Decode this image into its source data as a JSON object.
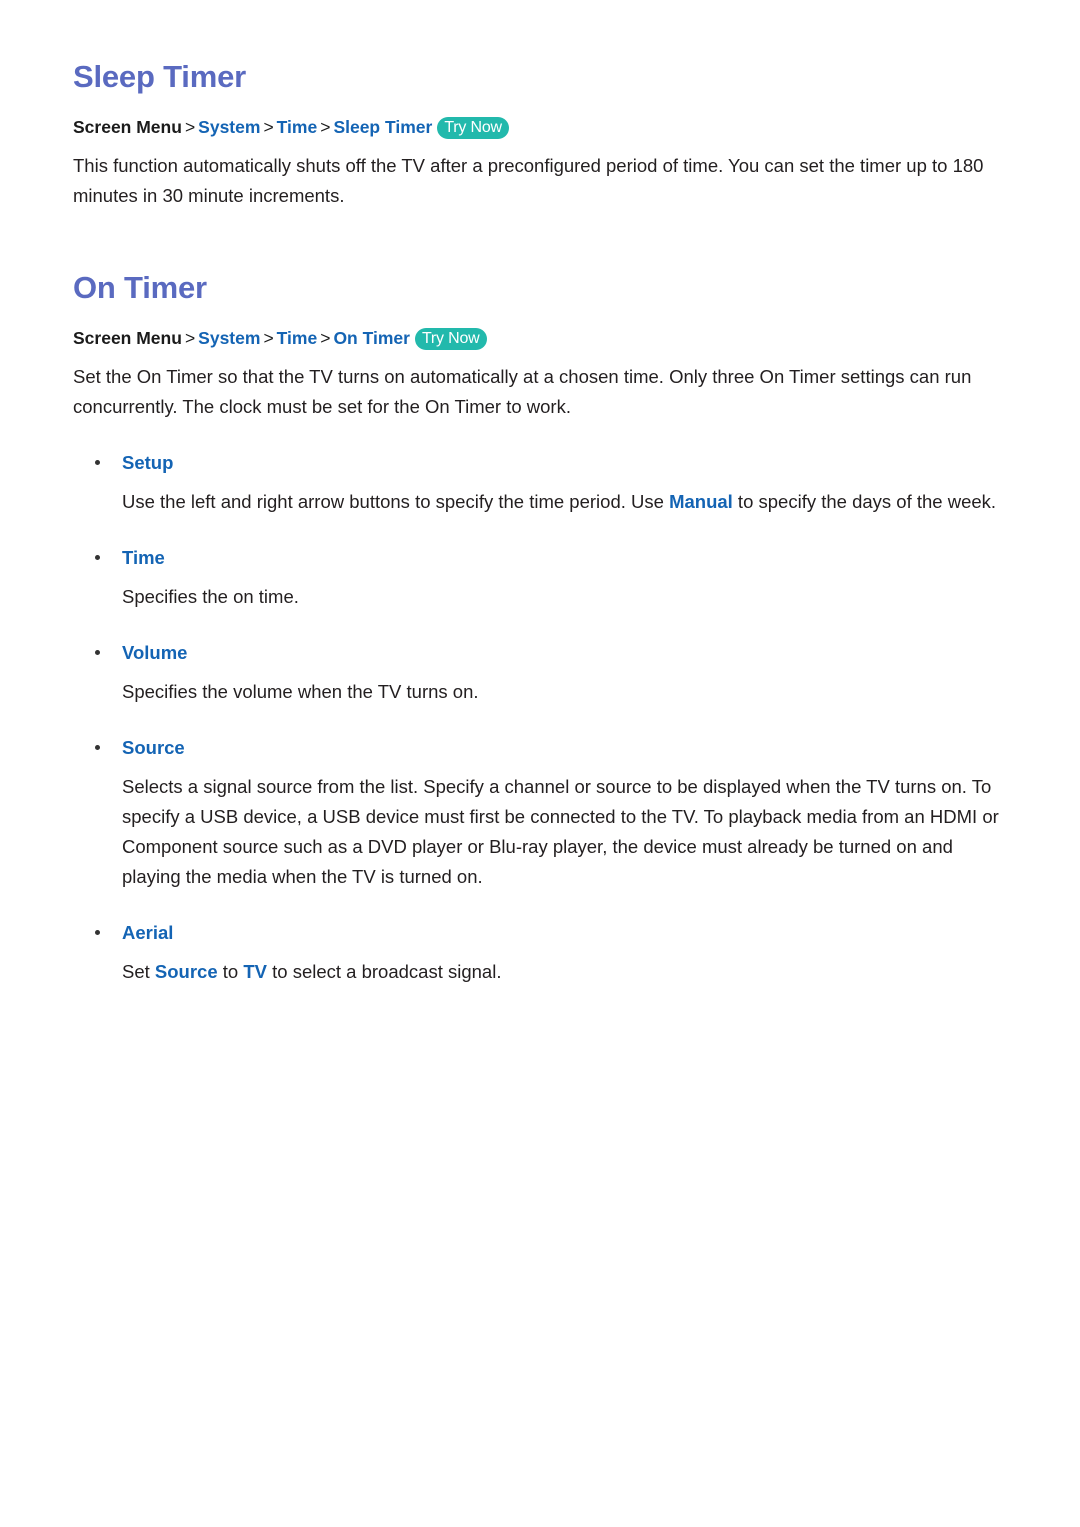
{
  "document": {
    "sections": [
      {
        "id": "sleep-timer",
        "title": "Sleep Timer",
        "breadcrumb": {
          "root": "Screen Menu",
          "separator": ">",
          "links": [
            "System",
            "Time",
            "Sleep Timer"
          ],
          "badge": "Try Now"
        },
        "paragraph": "This function automatically shuts off the TV after a preconfigured period of time. You can set the timer up to 180 minutes in 30 minute increments."
      },
      {
        "id": "on-timer",
        "title": "On Timer",
        "breadcrumb": {
          "root": "Screen Menu",
          "separator": ">",
          "links": [
            "System",
            "Time",
            "On Timer"
          ],
          "badge": "Try Now"
        },
        "paragraph": "Set the On Timer so that the TV turns on automatically at a chosen time. Only three On Timer settings can run concurrently. The clock must be set for the On Timer to work.",
        "bullets": [
          {
            "label": "Setup",
            "desc_pre": "Use the left and right arrow buttons to specify the time period. Use ",
            "desc_link": "Manual",
            "desc_post": " to specify the days of the week."
          },
          {
            "label": "Time",
            "desc_pre": "Specifies the on time.",
            "desc_link": "",
            "desc_post": ""
          },
          {
            "label": "Volume",
            "desc_pre": "Specifies the volume when the TV turns on.",
            "desc_link": "",
            "desc_post": ""
          },
          {
            "label": "Source",
            "desc_pre": "Selects a signal source from the list. Specify a channel or source to be displayed when the TV turns on. To specify a USB device, a USB device must first be connected to the TV. To playback media from an HDMI or Component source such as a DVD player or Blu-ray player, the device must already be turned on and playing the media when the TV is turned on.",
            "desc_link": "",
            "desc_post": ""
          },
          {
            "label": "Aerial",
            "desc_pre": "Set ",
            "desc_link": "Source",
            "desc_mid": " to ",
            "desc_link2": "TV",
            "desc_post": " to select a broadcast signal."
          }
        ]
      }
    ],
    "colors": {
      "heading": "#5a6ac0",
      "link": "#1464b4",
      "badge_bg": "#22b9ac",
      "badge_text": "#ffffff",
      "body_text": "#231f20"
    }
  }
}
